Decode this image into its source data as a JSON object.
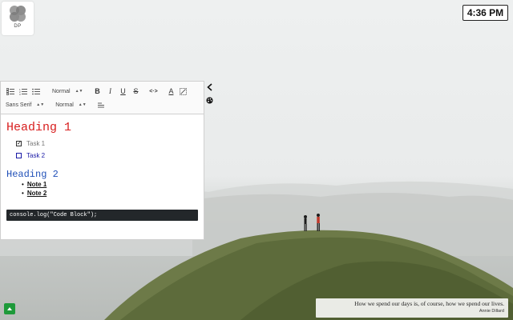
{
  "logo": {
    "label": "DP",
    "icon": "dp-logo-icon"
  },
  "clock": {
    "time": "4:36 PM"
  },
  "editor": {
    "toolbar": {
      "row1": {
        "heading_select": "Normal",
        "bold_label": "B",
        "italic_label": "I",
        "underline_label": "U",
        "strike_label": "S",
        "code_label": "<·>",
        "font_color_label": "A"
      },
      "row2": {
        "font_family_select": "Sans Serif",
        "font_size_select": "Normal"
      }
    },
    "content": {
      "heading1": "Heading 1",
      "tasks": [
        {
          "label": "Task 1",
          "checked": true
        },
        {
          "label": "Task 2",
          "checked": false
        }
      ],
      "heading2": "Heading 2",
      "notes": [
        {
          "label": "Note 1"
        },
        {
          "label": "Note 2"
        }
      ],
      "code": "console.log(\"Code Block\");"
    }
  },
  "quote": {
    "text": "How we spend our days is, of course, how we spend our lives.",
    "author": "Annie Dillard"
  },
  "colors": {
    "heading1": "#d81e1e",
    "heading2": "#2050b8",
    "task2": "#1a1aa6",
    "code_bg": "#23272a",
    "up_button": "#1e9a3a"
  }
}
